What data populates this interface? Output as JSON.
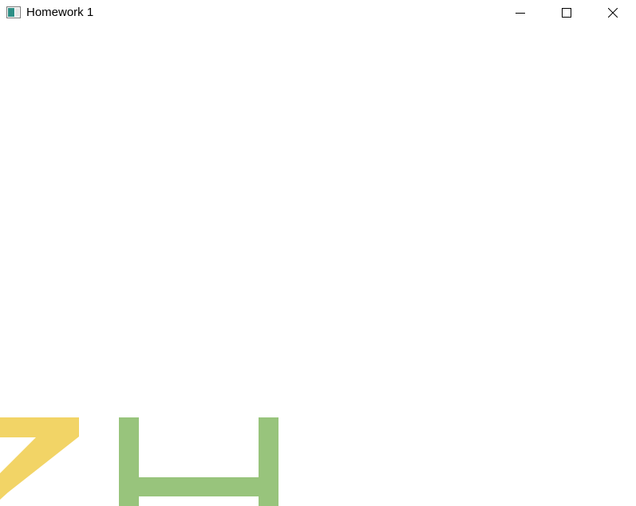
{
  "window": {
    "title": "Homework 1",
    "icon": "app-window-icon"
  },
  "caption_buttons": {
    "minimize_icon": "minimize-icon",
    "maximize_icon": "maximize-icon",
    "close_icon": "close-icon"
  },
  "canvas": {
    "background": "#ffffff",
    "shapes": [
      {
        "name": "yellow-glyph",
        "color": "#f2d466"
      },
      {
        "name": "green-glyph",
        "color": "#98c47c"
      }
    ]
  }
}
